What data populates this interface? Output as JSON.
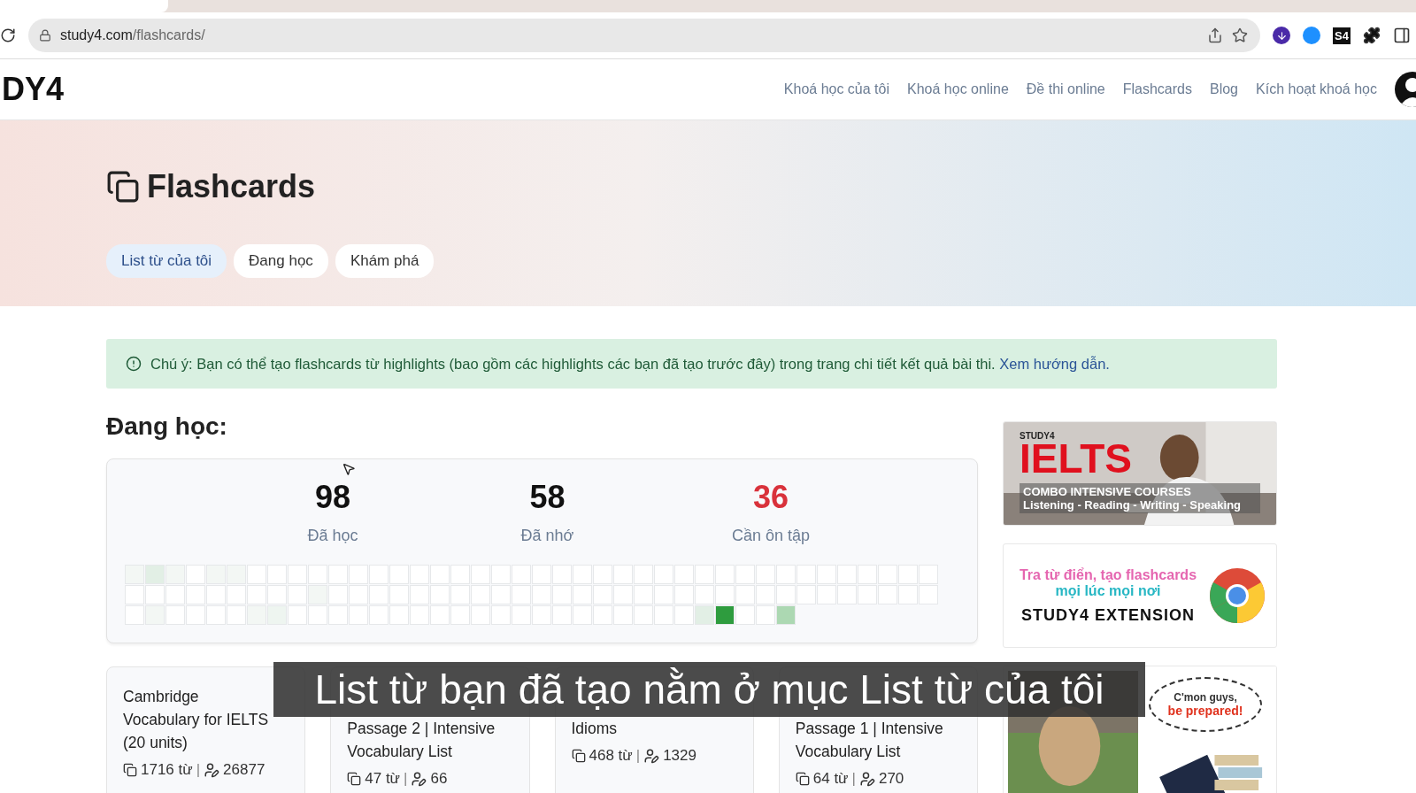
{
  "browser": {
    "url_host": "study4.com",
    "url_path": "/flashcards/",
    "extension_badge": "S4"
  },
  "site": {
    "logo": "DY4",
    "nav": [
      {
        "label": "Khoá học của tôi"
      },
      {
        "label": "Khoá học online"
      },
      {
        "label": "Đề thi online"
      },
      {
        "label": "Flashcards"
      },
      {
        "label": "Blog"
      },
      {
        "label": "Kích hoạt khoá học"
      }
    ]
  },
  "hero": {
    "title": "Flashcards",
    "tabs": [
      {
        "label": "List từ của tôi",
        "selected": true
      },
      {
        "label": "Đang học",
        "selected": false
      },
      {
        "label": "Khám phá",
        "selected": false
      }
    ]
  },
  "notice": {
    "text": "Chú ý: Bạn có thể tạo flashcards từ highlights (bao gồm các highlights các bạn đã tạo trước đây) trong trang chi tiết kết quả bài thi.",
    "link": "Xem hướng dẫn."
  },
  "learning": {
    "heading": "Đang học:",
    "stats": [
      {
        "value": "98",
        "label": "Đã học",
        "kind": "normal"
      },
      {
        "value": "58",
        "label": "Đã nhớ",
        "kind": "normal"
      },
      {
        "value": "36",
        "label": "Cần ôn tập",
        "kind": "alert"
      }
    ],
    "heatmap": [
      {
        "cells": [
          {
            "color": "#f3f7f4"
          },
          {
            "color": "#e2efe5"
          },
          {
            "color": "#f3f7f4"
          },
          {
            "color": "#ffffff"
          },
          {
            "color": "#f3f7f4"
          },
          {
            "color": "#f3f7f4"
          },
          {
            "color": "#ffffff"
          },
          {
            "color": "#ffffff"
          },
          {
            "color": "#ffffff"
          },
          {
            "color": "#ffffff"
          },
          {
            "color": "#ffffff"
          },
          {
            "color": "#ffffff"
          },
          {
            "color": "#ffffff"
          },
          {
            "color": "#ffffff"
          },
          {
            "color": "#ffffff"
          },
          {
            "color": "#ffffff"
          },
          {
            "color": "#ffffff"
          },
          {
            "color": "#ffffff"
          },
          {
            "color": "#ffffff"
          },
          {
            "color": "#ffffff"
          },
          {
            "color": "#ffffff"
          },
          {
            "color": "#ffffff"
          },
          {
            "color": "#ffffff"
          },
          {
            "color": "#ffffff"
          },
          {
            "color": "#ffffff"
          },
          {
            "color": "#ffffff"
          },
          {
            "color": "#ffffff"
          },
          {
            "color": "#ffffff"
          },
          {
            "color": "#ffffff"
          },
          {
            "color": "#ffffff"
          },
          {
            "color": "#ffffff"
          },
          {
            "color": "#ffffff"
          },
          {
            "color": "#ffffff"
          },
          {
            "color": "#ffffff"
          },
          {
            "color": "#ffffff"
          },
          {
            "color": "#ffffff"
          },
          {
            "color": "#ffffff"
          },
          {
            "color": "#ffffff"
          },
          {
            "color": "#ffffff"
          },
          {
            "color": "#ffffff"
          }
        ]
      },
      {
        "cells": [
          {
            "color": "#ffffff"
          },
          {
            "color": "#ffffff"
          },
          {
            "color": "#ffffff"
          },
          {
            "color": "#ffffff"
          },
          {
            "color": "#ffffff"
          },
          {
            "color": "#ffffff"
          },
          {
            "color": "#ffffff"
          },
          {
            "color": "#ffffff"
          },
          {
            "color": "#ffffff"
          },
          {
            "color": "#f3f7f4"
          },
          {
            "color": "#ffffff"
          },
          {
            "color": "#ffffff"
          },
          {
            "color": "#ffffff"
          },
          {
            "color": "#ffffff"
          },
          {
            "color": "#ffffff"
          },
          {
            "color": "#ffffff"
          },
          {
            "color": "#ffffff"
          },
          {
            "color": "#ffffff"
          },
          {
            "color": "#ffffff"
          },
          {
            "color": "#ffffff"
          },
          {
            "color": "#ffffff"
          },
          {
            "color": "#ffffff"
          },
          {
            "color": "#ffffff"
          },
          {
            "color": "#ffffff"
          },
          {
            "color": "#ffffff"
          },
          {
            "color": "#ffffff"
          },
          {
            "color": "#ffffff"
          },
          {
            "color": "#ffffff"
          },
          {
            "color": "#ffffff"
          },
          {
            "color": "#ffffff"
          },
          {
            "color": "#ffffff"
          },
          {
            "color": "#ffffff"
          },
          {
            "color": "#ffffff"
          },
          {
            "color": "#ffffff"
          },
          {
            "color": "#ffffff"
          },
          {
            "color": "#ffffff"
          },
          {
            "color": "#ffffff"
          },
          {
            "color": "#ffffff"
          },
          {
            "color": "#ffffff"
          },
          {
            "color": "#ffffff"
          }
        ]
      },
      {
        "cells": [
          {
            "color": "#ffffff"
          },
          {
            "color": "#f3f7f4"
          },
          {
            "color": "#ffffff"
          },
          {
            "color": "#ffffff"
          },
          {
            "color": "#ffffff"
          },
          {
            "color": "#ffffff"
          },
          {
            "color": "#f3f7f4"
          },
          {
            "color": "#eef5f0"
          },
          {
            "color": "#ffffff"
          },
          {
            "color": "#ffffff"
          },
          {
            "color": "#ffffff"
          },
          {
            "color": "#ffffff"
          },
          {
            "color": "#ffffff"
          },
          {
            "color": "#ffffff"
          },
          {
            "color": "#ffffff"
          },
          {
            "color": "#ffffff"
          },
          {
            "color": "#ffffff"
          },
          {
            "color": "#ffffff"
          },
          {
            "color": "#ffffff"
          },
          {
            "color": "#ffffff"
          },
          {
            "color": "#ffffff"
          },
          {
            "color": "#ffffff"
          },
          {
            "color": "#ffffff"
          },
          {
            "color": "#ffffff"
          },
          {
            "color": "#ffffff"
          },
          {
            "color": "#ffffff"
          },
          {
            "color": "#ffffff"
          },
          {
            "color": "#ffffff"
          },
          {
            "color": "#e2efe5"
          },
          {
            "color": "#2e9c3e"
          },
          {
            "color": "#ffffff"
          },
          {
            "color": "#ffffff"
          },
          {
            "color": "#acd8b2"
          }
        ]
      }
    ]
  },
  "lists": [
    {
      "covered": false,
      "title": "Cambridge Vocabulary for IELTS (20 units)",
      "words": "1716 từ",
      "separator": "|",
      "learners": "26877"
    },
    {
      "covered": true,
      "title": "Passage 2 | Intensive Vocabulary List",
      "words": "47 từ",
      "separator": "|",
      "learners": "66"
    },
    {
      "covered": true,
      "title": "Idioms",
      "words": "468 từ",
      "separator": "|",
      "learners": "1329"
    },
    {
      "covered": true,
      "title": "Passage 1 | Intensive Vocabulary List",
      "words": "64 từ",
      "separator": "|",
      "learners": "270"
    }
  ],
  "ads": [
    {
      "kind": "course",
      "brand": "STUDY4",
      "title": "IELTS",
      "line1": "COMBO INTENSIVE COURSES",
      "line2": "Listening - Reading - Writing - Speaking"
    },
    {
      "kind": "extension",
      "line1": "Tra từ điển, tạo flashcards",
      "line2": "mọi lúc mọi nơi",
      "line3": "STUDY4 EXTENSION"
    },
    {
      "kind": "meme",
      "line1": "C'mon guys,",
      "line2": "be prepared!"
    }
  ],
  "caption": "List từ bạn đã tạo nằm ở mục List từ của tôi"
}
